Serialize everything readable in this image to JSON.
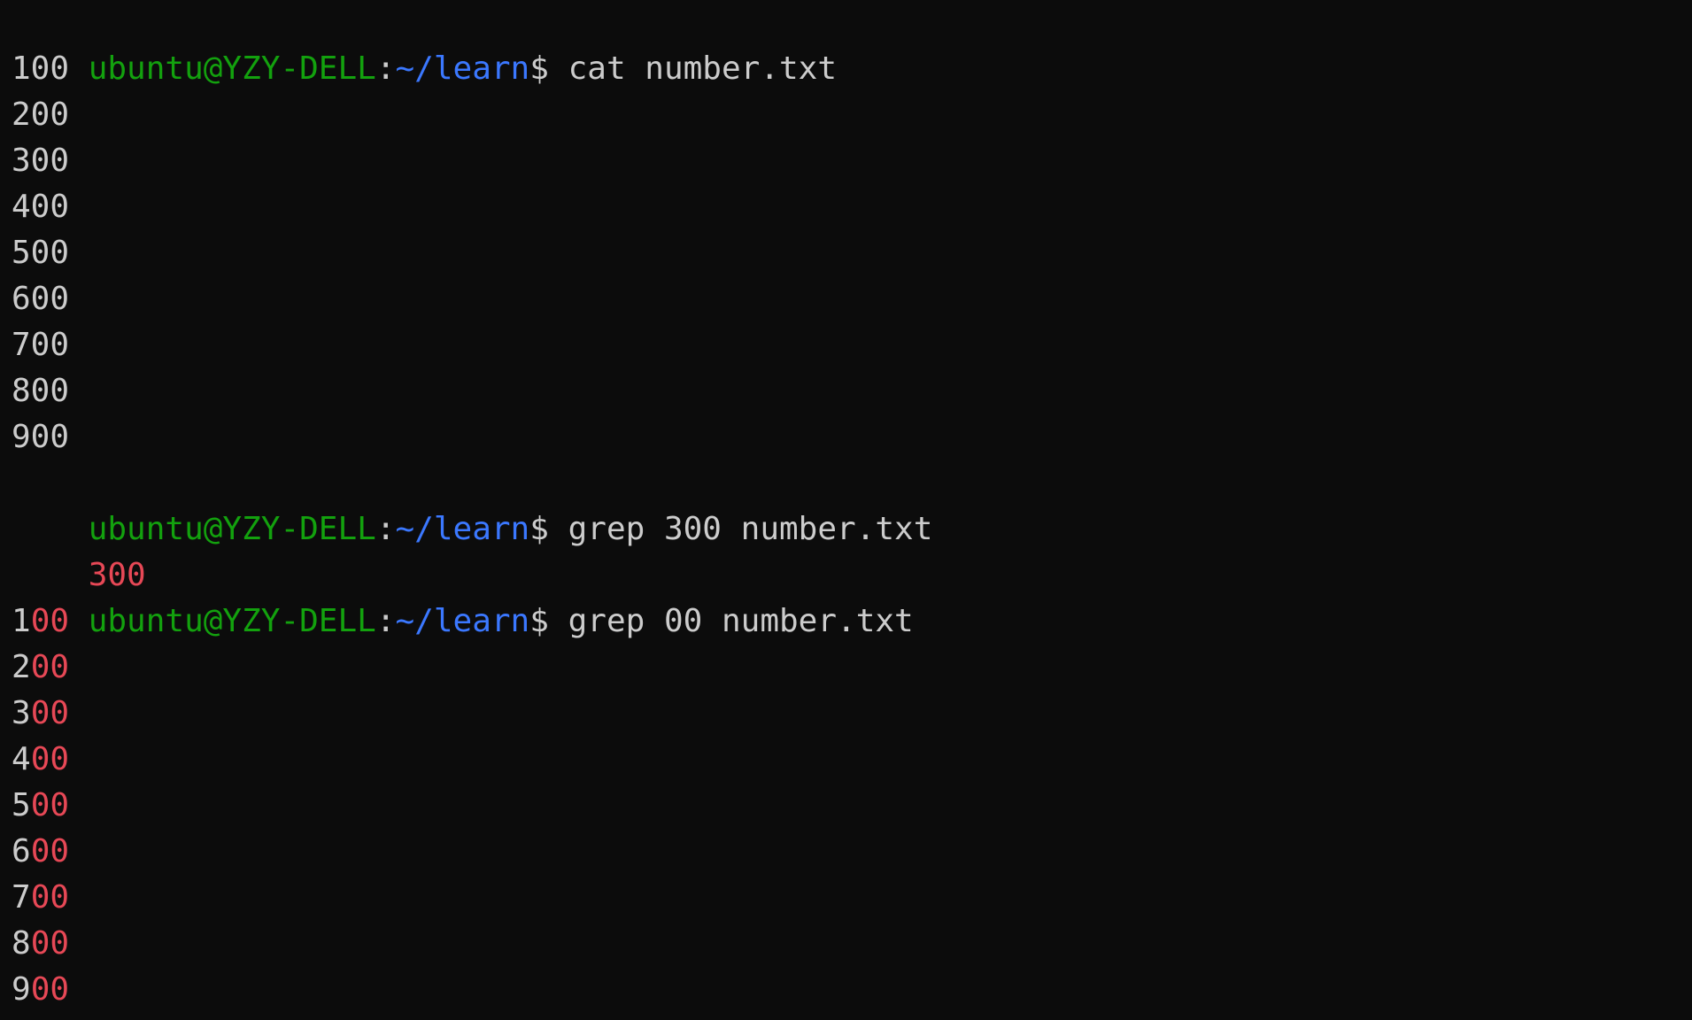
{
  "prompt": {
    "user_host": "ubuntu@YZY-DELL",
    "colon": ":",
    "path": "~/learn",
    "dollar": "$"
  },
  "colors": {
    "background": "#0c0c0c",
    "text": "#cccccc",
    "prompt_user": "#13a10e",
    "prompt_path": "#3b78ff",
    "grep_match": "#e74856"
  },
  "commands": {
    "cat": "cat number.txt",
    "grep1": "grep 300 number.txt",
    "grep2": "grep 00 number.txt"
  },
  "cat_output": [
    "100",
    "200",
    "300",
    "400",
    "500",
    "600",
    "700",
    "800",
    "900"
  ],
  "grep1_output": {
    "match": "300"
  },
  "grep2_output": [
    {
      "prefix": "1",
      "match": "00"
    },
    {
      "prefix": "2",
      "match": "00"
    },
    {
      "prefix": "3",
      "match": "00"
    },
    {
      "prefix": "4",
      "match": "00"
    },
    {
      "prefix": "5",
      "match": "00"
    },
    {
      "prefix": "6",
      "match": "00"
    },
    {
      "prefix": "7",
      "match": "00"
    },
    {
      "prefix": "8",
      "match": "00"
    },
    {
      "prefix": "9",
      "match": "00"
    }
  ]
}
